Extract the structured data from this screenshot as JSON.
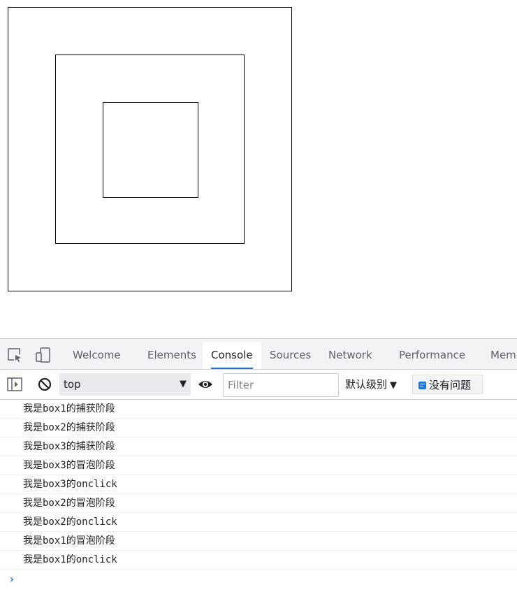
{
  "tabs": {
    "welcome": "Welcome",
    "elements": "Elements",
    "console": "Console",
    "sources": "Sources",
    "network": "Network",
    "performance": "Performance",
    "memory": "Mem"
  },
  "toolbar": {
    "context": "top",
    "filter_placeholder": "Filter",
    "levels": "默认级别",
    "issues": "没有问题"
  },
  "console_lines": [
    "我是box1的捕获阶段",
    "我是box2的捕获阶段",
    "我是box3的捕获阶段",
    "我是box3的冒泡阶段",
    "我是box3的onclick",
    "我是box2的冒泡阶段",
    "我是box2的onclick",
    "我是box1的冒泡阶段",
    "我是box1的onclick"
  ],
  "prompt": "›",
  "colors": {
    "accent": "#1a73e8",
    "tabbar_bg": "#f1f3f4",
    "border": "#cacdd1"
  },
  "icons": [
    "inspect-element-icon",
    "device-toolbar-icon",
    "sidebar-toggle-icon",
    "clear-console-icon",
    "live-expression-eye-icon",
    "issues-icon"
  ]
}
